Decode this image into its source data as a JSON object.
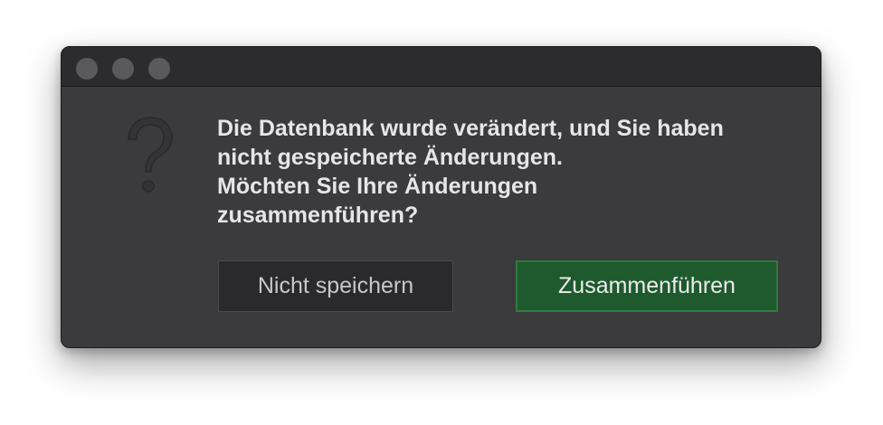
{
  "dialog": {
    "message": "Die Datenbank wurde verändert, und Sie haben\nnicht gespeicherte Änderungen.\nMöchten Sie Ihre Änderungen\nzusammenführen?",
    "icon": "question-mark-icon",
    "buttons": {
      "dont_save_label": "Nicht speichern",
      "merge_label": "Zusammenführen"
    }
  },
  "colors": {
    "window_bg": "#3b3b3d",
    "titlebar_bg": "#2c2c2e",
    "primary_button_bg": "#1f5a2e",
    "secondary_button_bg": "#2a2a2c",
    "text": "#e6e6e8"
  }
}
